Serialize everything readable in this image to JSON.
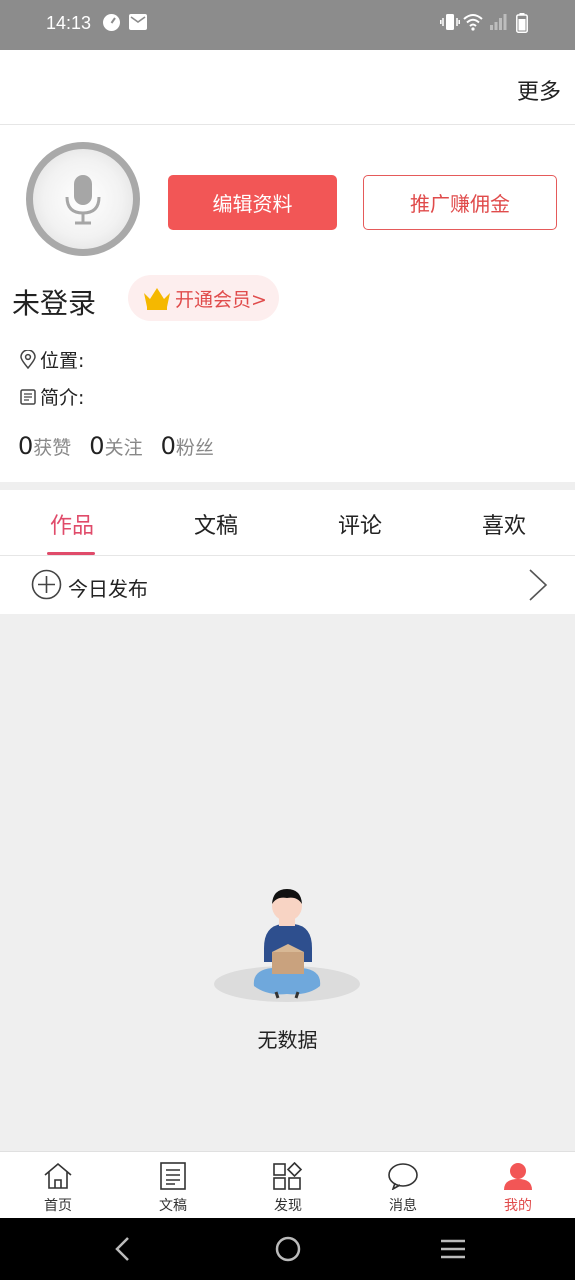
{
  "status_bar": {
    "time": "14:13"
  },
  "header": {
    "more_label": "更多"
  },
  "profile": {
    "edit_label": "编辑资料",
    "promo_label": "推广赚佣金",
    "username": "未登录",
    "vip_label": "开通会员>",
    "location_label": "位置:",
    "bio_label": "简介:",
    "stats": [
      {
        "value": "0",
        "label": "获赞"
      },
      {
        "value": "0",
        "label": "关注"
      },
      {
        "value": "0",
        "label": "粉丝"
      }
    ]
  },
  "tabs": [
    {
      "label": "作品",
      "active": true
    },
    {
      "label": "文稿"
    },
    {
      "label": "评论"
    },
    {
      "label": "喜欢"
    }
  ],
  "publish": {
    "label": "今日发布"
  },
  "empty": {
    "text": "无数据"
  },
  "bottom_nav": [
    {
      "label": "首页",
      "icon": "home-icon"
    },
    {
      "label": "文稿",
      "icon": "document-icon"
    },
    {
      "label": "发现",
      "icon": "discover-icon"
    },
    {
      "label": "消息",
      "icon": "message-icon"
    },
    {
      "label": "我的",
      "icon": "profile-icon",
      "active": true
    }
  ],
  "colors": {
    "accent": "#f25656",
    "tab_active": "#e04b6a",
    "status_bar": "#8c8c8c"
  }
}
